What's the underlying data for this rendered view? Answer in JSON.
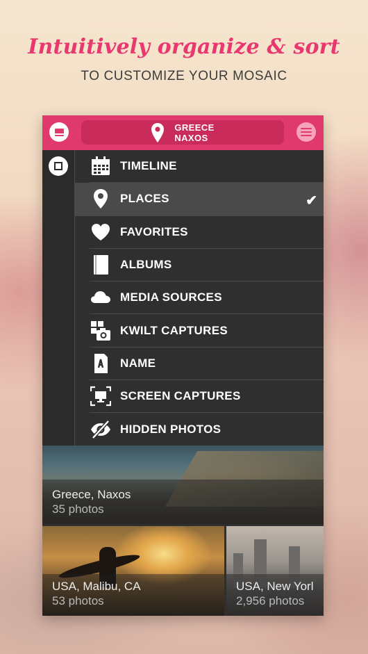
{
  "promo": {
    "headline": "Intuitively organize & sort",
    "subheadline": "TO CUSTOMIZE YOUR MOSAIC"
  },
  "colors": {
    "accent": "#e0396d",
    "panel": "#2f2f2f",
    "selected_row": "#4a4a4a"
  },
  "topbar": {
    "left_icon": "mosaic-icon",
    "location_line1": "GREECE",
    "location_line2": "NAXOS",
    "right_icon": "menu-icon"
  },
  "sort_menu": {
    "items": [
      {
        "label": "TIMELINE",
        "icon": "calendar-icon"
      },
      {
        "label": "PLACES",
        "icon": "map-pin-icon",
        "selected": true
      },
      {
        "label": "FAVORITES",
        "icon": "heart-icon"
      },
      {
        "label": "ALBUMS",
        "icon": "album-icon"
      },
      {
        "label": "MEDIA SOURCES",
        "icon": "cloud-icon"
      },
      {
        "label": "KWILT CAPTURES",
        "icon": "camera-grid-icon"
      },
      {
        "label": "NAME",
        "icon": "letter-a-icon"
      },
      {
        "label": "SCREEN CAPTURES",
        "icon": "screen-capture-icon"
      },
      {
        "label": "HIDDEN PHOTOS",
        "icon": "eye-slash-icon"
      }
    ]
  },
  "albums": [
    {
      "title": "Greece, Naxos",
      "count": "35 photos"
    },
    {
      "title": "USA, Malibu, CA",
      "count": "53 photos"
    },
    {
      "title": "USA, New Yorl",
      "count": "2,956 photos"
    }
  ]
}
